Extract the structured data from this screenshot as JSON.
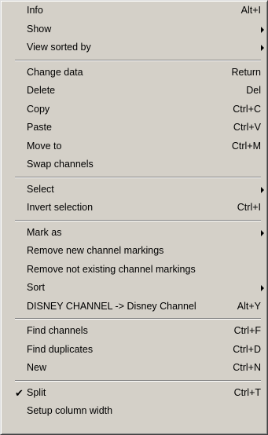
{
  "menu": {
    "info": {
      "label": "Info",
      "shortcut": "Alt+I"
    },
    "show": {
      "label": "Show"
    },
    "view_sorted_by": {
      "label": "View sorted by"
    },
    "change_data": {
      "label": "Change data",
      "shortcut": "Return"
    },
    "delete": {
      "label": "Delete",
      "shortcut": "Del"
    },
    "copy": {
      "label": "Copy",
      "shortcut": "Ctrl+C"
    },
    "paste": {
      "label": "Paste",
      "shortcut": "Ctrl+V"
    },
    "move_to": {
      "label": "Move to",
      "shortcut": "Ctrl+M"
    },
    "swap_channels": {
      "label": "Swap channels"
    },
    "select": {
      "label": "Select"
    },
    "invert_selection": {
      "label": "Invert selection",
      "shortcut": "Ctrl+I"
    },
    "mark_as": {
      "label": "Mark as"
    },
    "remove_new_markings": {
      "label": "Remove new channel markings"
    },
    "remove_not_existing_markings": {
      "label": "Remove not existing channel markings"
    },
    "sort": {
      "label": "Sort"
    },
    "disney_channel": {
      "label": "DISNEY CHANNEL -> Disney Channel",
      "shortcut": "Alt+Y"
    },
    "find_channels": {
      "label": "Find channels",
      "shortcut": "Ctrl+F"
    },
    "find_duplicates": {
      "label": "Find duplicates",
      "shortcut": "Ctrl+D"
    },
    "new": {
      "label": "New",
      "shortcut": "Ctrl+N"
    },
    "split": {
      "label": "Split",
      "shortcut": "Ctrl+T",
      "check_glyph": "✔"
    },
    "setup_column_width": {
      "label": "Setup column width"
    }
  }
}
